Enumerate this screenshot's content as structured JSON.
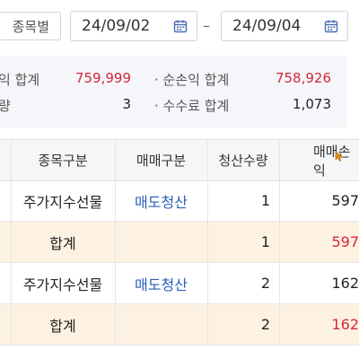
{
  "filters": {
    "stock_button": "종목별",
    "start_date": "24/09/02",
    "separator": "–",
    "end_date": "24/09/04"
  },
  "summary": {
    "left": [
      {
        "label": "익 합계",
        "value": "759,999"
      },
      {
        "label": "량",
        "value": "3"
      }
    ],
    "right": [
      {
        "label": "· 순손익 합계",
        "value": "758,926"
      },
      {
        "label": "· 수수료 합계",
        "value": "1,073"
      }
    ]
  },
  "table": {
    "headers": [
      "종목구분",
      "매매구분",
      "청산수량",
      "매매손익"
    ],
    "rows": [
      {
        "type": "data",
        "item": "주가지수선물",
        "trade": "매도청산",
        "qty": "1",
        "pnl": "597"
      },
      {
        "type": "total",
        "item": "합계",
        "trade": "",
        "qty": "1",
        "pnl": "597"
      },
      {
        "type": "data",
        "item": "주가지수선물",
        "trade": "매도청산",
        "qty": "2",
        "pnl": "162"
      },
      {
        "type": "total",
        "item": "합계",
        "trade": "",
        "qty": "2",
        "pnl": "162"
      }
    ]
  },
  "colors": {
    "accent_red": "#d6263a",
    "accent_blue": "#2a5fb8",
    "total_row_bg": "#fdf1e2",
    "summary_bg": "#f4f6f9"
  },
  "icons": [
    "calendar-icon",
    "cursor-icon"
  ]
}
